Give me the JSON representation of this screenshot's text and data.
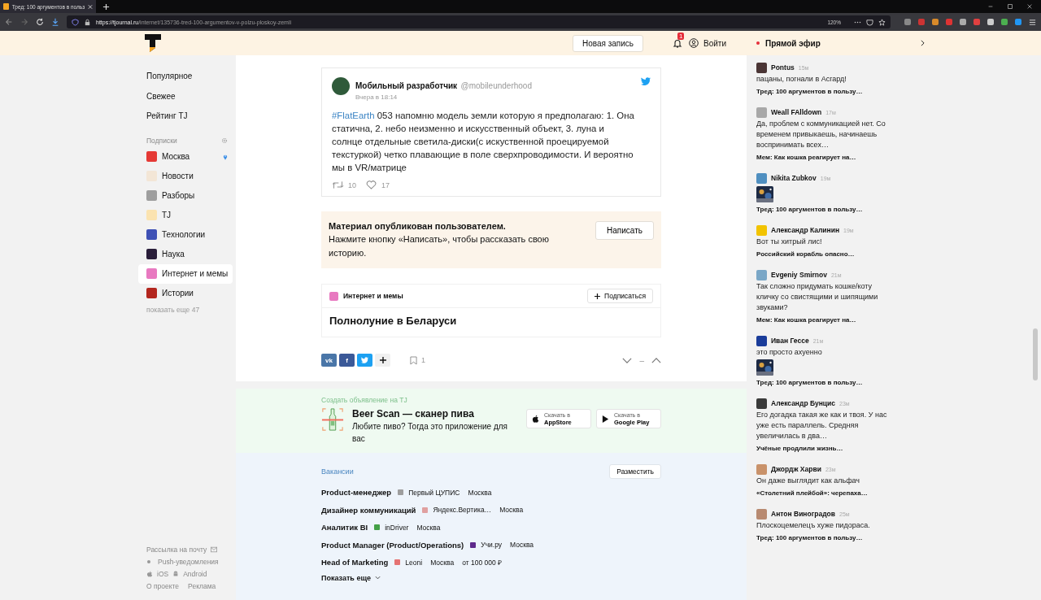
{
  "browser": {
    "tab_title": "Тред: 100 аргументов в польз",
    "url_host": "https://tjournal.ru",
    "url_path": "/internet/135736-tred-100-argumentov-v-polzu-ploskoy-zemli",
    "zoom": "120%"
  },
  "header": {
    "new_post": "Новая запись",
    "notifications": "1",
    "login": "Войти",
    "live": "Прямой эфир"
  },
  "sidebar": {
    "nav": [
      {
        "label": "Популярное"
      },
      {
        "label": "Свежее"
      },
      {
        "label": "Рейтинг TJ"
      }
    ],
    "subscriptions_title": "Подписки",
    "subscriptions": [
      {
        "label": "Москва",
        "color": "#e53935",
        "selected": false,
        "pinned": true
      },
      {
        "label": "Новости",
        "color": "#f3e6d6",
        "selected": false,
        "pinned": false
      },
      {
        "label": "Разборы",
        "color": "#9e9e9e",
        "selected": false,
        "pinned": false
      },
      {
        "label": "TJ",
        "color": "#fbe3b0",
        "selected": false,
        "pinned": false
      },
      {
        "label": "Технологии",
        "color": "#3f51b5",
        "selected": false,
        "pinned": false
      },
      {
        "label": "Наука",
        "color": "#2a1e3a",
        "selected": false,
        "pinned": false
      },
      {
        "label": "Интернет и мемы",
        "color": "#e879c0",
        "selected": true,
        "pinned": false
      },
      {
        "label": "Истории",
        "color": "#b3261e",
        "selected": false,
        "pinned": false
      }
    ],
    "show_more": "показать еще 47",
    "footer": {
      "newsletter": "Рассылка на почту",
      "push": "Push-уведомления",
      "ios": "iOS",
      "android": "Android",
      "about": "О проекте",
      "ads": "Реклама"
    }
  },
  "tweet": {
    "author": "Мобильный разработчик",
    "handle": "@mobileunderhood",
    "time": "Вчера в 18:14",
    "hashtag": "#FlatEarth",
    "text": "053 напомню модель земли которую я предполагаю: 1. Она статична, 2. небо неизменно и искусственный объект, 3. луна и солнце отдельные светила-диски(с искуственной проецируемой текстуркой) четко плавающие в поле сверхпроводимости. И вероятно мы в VR/матрице",
    "retweets": "10",
    "likes": "17"
  },
  "notice": {
    "title": "Материал опубликован пользователем.",
    "text": "Нажмите кнопку «Написать», чтобы рассказать свою историю.",
    "button": "Написать"
  },
  "related": {
    "category": "Интернет и мемы",
    "subscribe": "Подписаться",
    "title": "Полнолуние в Беларуси"
  },
  "share": {
    "buttons": [
      {
        "kind": "vk",
        "label": "vk"
      },
      {
        "kind": "facebook",
        "label": "f"
      },
      {
        "kind": "twitter"
      }
    ],
    "bookmarks": "1",
    "rating": "–"
  },
  "ad": {
    "label": "Создать объявление на TJ",
    "title": "Beer Scan — сканер пива",
    "text": "Любите пиво? Тогда это приложение для вас",
    "stores": [
      {
        "kind": "apple",
        "caption": "Скачать в",
        "name": "AppStore"
      },
      {
        "kind": "google",
        "caption": "Скачать в",
        "name": "Google Play"
      }
    ]
  },
  "vacancies": {
    "title": "Вакансии",
    "post": "Разместить",
    "rows": [
      {
        "position": "Product-менеджер",
        "company": "Первый ЦУПИС",
        "color": "#9e9e9e",
        "city": "Москва"
      },
      {
        "position": "Дизайнер коммуникаций",
        "company": "Яндекс.Вертика…",
        "color": "#e0a0a0",
        "city": "Москва"
      },
      {
        "position": "Аналитик BI",
        "company": "inDriver",
        "color": "#43a047",
        "city": "Москва"
      },
      {
        "position": "Product Manager (Product/Operations)",
        "company": "Учи.ру",
        "color": "#5e2a8c",
        "city": "Москва"
      },
      {
        "position": "Head of Marketing",
        "company": "Leoni",
        "color": "#e57373",
        "city": "Москва",
        "salary": "от 100 000 ₽"
      }
    ],
    "more": "Показать еще"
  },
  "comments": [
    {
      "author": "Pontus",
      "time": "15м",
      "color": "#4a3535",
      "text": "пацаны, погнали в Асгард!",
      "thread": "Тред: 100 аргументов в пользу…"
    },
    {
      "author": "Weall FAlldown",
      "time": "17м",
      "color": "#a8a8a8",
      "text": "Да, проблем с коммуникацией нет. Со временем привыкаешь, начинаешь воспринимать всех…",
      "thread": "Мем: Как кошка реагирует на…"
    },
    {
      "author": "Nikita Zubkov",
      "time": "19м",
      "color": "#4f8fc0",
      "thread": "Тред: 100 аргументов в пользу…"
    },
    {
      "author": "Александр Калинин",
      "time": "19м",
      "color": "#f2c300",
      "text": "Вот ты хитрый лис!",
      "thread": "Российский корабль опасно…"
    },
    {
      "author": "Evgeniy Smirnov",
      "time": "21м",
      "color": "#7aa7c7",
      "text": "Так сложно придумать кошке/коту кличку со свистящими и шипящими звуками?",
      "thread": "Мем: Как кошка реагирует на…"
    },
    {
      "author": "Иван Гессе",
      "time": "21м",
      "color": "#1a3c9a",
      "text": "это просто ахуенно",
      "thread": "Тред: 100 аргументов в пользу…"
    },
    {
      "author": "Александр Бунцис",
      "time": "23м",
      "color": "#3a3a3a",
      "text": "Его догадка такая же как и твоя. У нас уже есть параллель. Средняя увеличилась в два…",
      "thread": "Учёные продлили жизнь…"
    },
    {
      "author": "Джордж Харви",
      "time": "23м",
      "color": "#c9926a",
      "text": "Он даже выглядит как альфач",
      "thread": "«Столетний плейбой»: черепаха…"
    },
    {
      "author": "Антон Виноградов",
      "time": "25м",
      "color": "#b88a70",
      "text": "Плоскоцемелецъ хуже пидораса.",
      "thread": "Тред: 100 аргументов в пользу…"
    }
  ]
}
